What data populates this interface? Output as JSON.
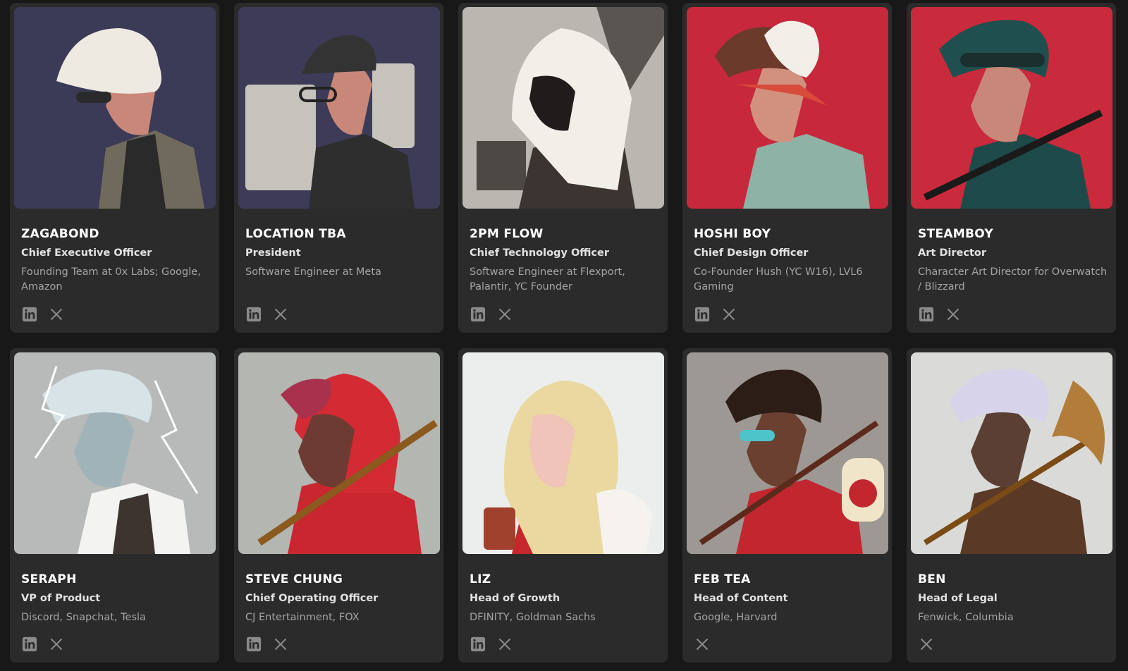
{
  "team": [
    {
      "name": "ZAGABOND",
      "role": "Chief Executive Officer",
      "bio": "Founding Team at 0x Labs; Google, Amazon",
      "linkedin": true,
      "x": true,
      "bg": "#3b3a57"
    },
    {
      "name": "LOCATION TBA",
      "role": "President",
      "bio": "Software Engineer at Meta",
      "linkedin": true,
      "x": true,
      "bg": "#3d3b58"
    },
    {
      "name": "2PM FLOW",
      "role": "Chief Technology Officer",
      "bio": "Software Engineer at Flexport, Palantir, YC Founder",
      "linkedin": true,
      "x": true,
      "bg": "#b9b7b0"
    },
    {
      "name": "HOSHI BOY",
      "role": "Chief Design Officer",
      "bio": "Co-Founder Hush (YC W16), LVL6 Gaming",
      "linkedin": true,
      "x": true,
      "bg": "#c8283b"
    },
    {
      "name": "STEAMBOY",
      "role": "Art Director",
      "bio": "Character Art Director for Overwatch / Blizzard",
      "linkedin": true,
      "x": true,
      "bg": "#c92a3c"
    },
    {
      "name": "SERAPH",
      "role": "VP of Product",
      "bio": "Discord, Snapchat, Tesla",
      "linkedin": true,
      "x": true,
      "bg": "#b7bab9"
    },
    {
      "name": "STEVE CHUNG",
      "role": "Chief Operating Officer",
      "bio": "CJ Entertainment, FOX",
      "linkedin": true,
      "x": true,
      "bg": "#b4b6b1"
    },
    {
      "name": "LIZ",
      "role": "Head of Growth",
      "bio": "DFINITY, Goldman Sachs",
      "linkedin": true,
      "x": true,
      "bg": "#eceeed"
    },
    {
      "name": "FEB TEA",
      "role": "Head of Content",
      "bio": "Google, Harvard",
      "linkedin": false,
      "x": true,
      "bg": "#9e9894"
    },
    {
      "name": "BEN",
      "role": "Head of Legal",
      "bio": "Fenwick, Columbia",
      "linkedin": false,
      "x": true,
      "bg": "#dadbd8"
    }
  ]
}
